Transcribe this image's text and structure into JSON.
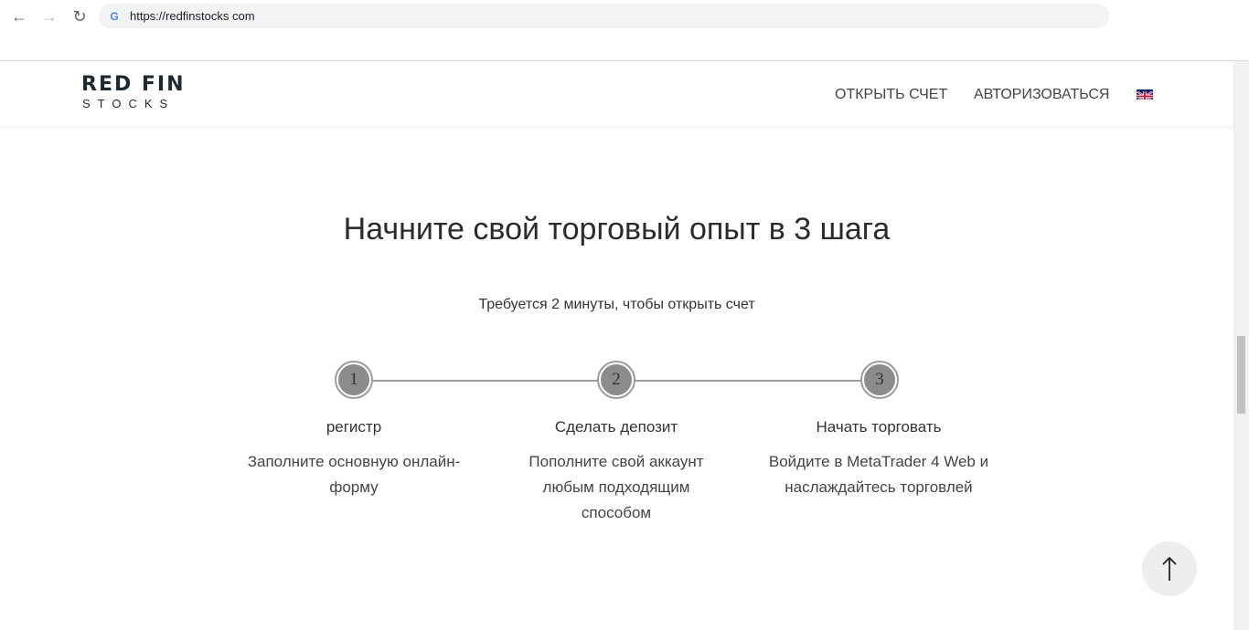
{
  "browser": {
    "url": "https://redfinstocks com"
  },
  "header": {
    "logo_top": "RED FIN",
    "logo_bottom": "STOCKS",
    "nav_open_account": "ОТКРЫТЬ СЧЕТ",
    "nav_login": "АВТОРИЗОВАТЬСЯ",
    "language_flag": "uk-flag-icon"
  },
  "main": {
    "title": "Начните свой торговый опыт в 3 шага",
    "subtitle": "Требуется 2 минуты, чтобы открыть счет",
    "steps": [
      {
        "number": "1",
        "title": "регистр",
        "description": "Заполните основную онлайн-форму"
      },
      {
        "number": "2",
        "title": "Сделать депозит",
        "description": "Пополните свой аккаунт любым подходящим способом"
      },
      {
        "number": "3",
        "title": "Начать торговать",
        "description": "Войдите в MetaTrader 4 Web и наслаждайтесь торговлей"
      }
    ]
  },
  "colors": {
    "step_circle": "#8c8c8c",
    "step_line": "#9b9b9b",
    "logo": "#1d2930"
  }
}
